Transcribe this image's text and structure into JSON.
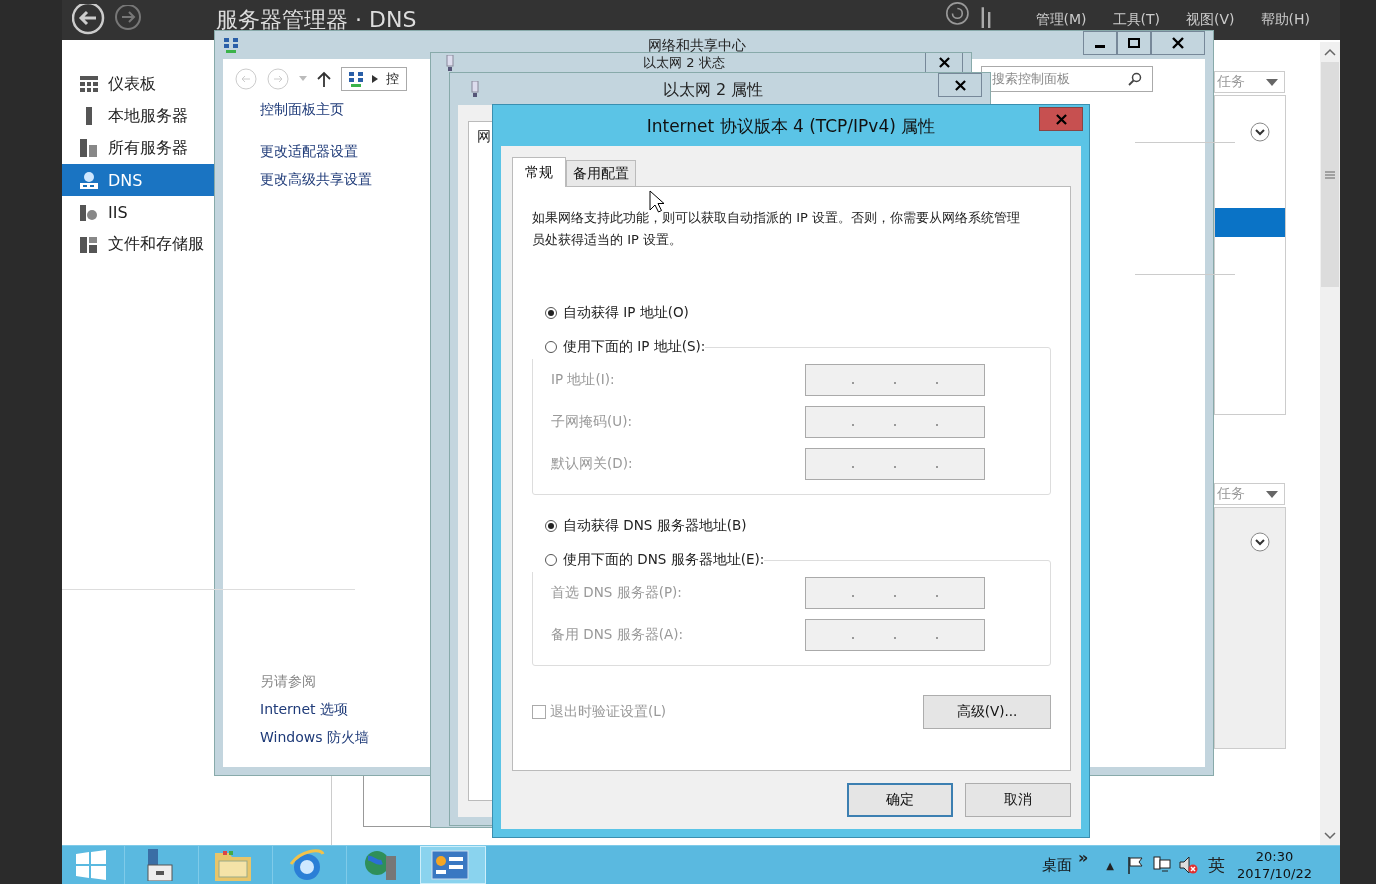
{
  "server_manager": {
    "title": "服务器管理器 · DNS",
    "menu": [
      {
        "label": "管理(M)"
      },
      {
        "label": "工具(T)"
      },
      {
        "label": "视图(V)"
      },
      {
        "label": "帮助(H)"
      }
    ],
    "sidebar": [
      {
        "label": "仪表板",
        "kind": "dashboard",
        "selected": false
      },
      {
        "label": "本地服务器",
        "kind": "server",
        "selected": false
      },
      {
        "label": "所有服务器",
        "kind": "servers",
        "selected": false
      },
      {
        "label": "DNS",
        "kind": "dns",
        "selected": true
      },
      {
        "label": "IIS",
        "kind": "iis",
        "selected": false
      },
      {
        "label": "文件和存储服",
        "kind": "storage",
        "selected": false
      }
    ],
    "task_menus": [
      {
        "label": "任务"
      },
      {
        "label": "任务"
      }
    ]
  },
  "network_center": {
    "title": "网络和共享中心",
    "address": "控",
    "search": {
      "placeholder": "搜索控制面板"
    },
    "links": [
      {
        "label": "控制面板主页"
      },
      {
        "label": "更改适配器设置"
      },
      {
        "label": "更改高级共享设置"
      }
    ],
    "see_also": {
      "heading": "另请参阅",
      "links": [
        {
          "label": "Internet 选项"
        },
        {
          "label": "Windows 防火墙"
        }
      ]
    }
  },
  "status_window": {
    "title": "以太网 2 状态"
  },
  "properties_window": {
    "title": "以太网 2 属性",
    "tab": "网"
  },
  "ipv4_dialog": {
    "title": "Internet 协议版本 4 (TCP/IPv4) 属性",
    "tabs": [
      {
        "label": "常规",
        "selected": true
      },
      {
        "label": "备用配置",
        "selected": false
      }
    ],
    "intro": "如果网络支持此功能，则可以获取自动指派的 IP 设置。否则，你需要从网络系统管理员处获得适当的 IP 设置。",
    "ip_options": [
      {
        "label": "自动获得 IP 地址(O)",
        "selected": true
      },
      {
        "label": "使用下面的 IP 地址(S):",
        "selected": false
      }
    ],
    "ip_fields": [
      {
        "label": "IP 地址(I):",
        "disabled": true
      },
      {
        "label": "子网掩码(U):",
        "disabled": true
      },
      {
        "label": "默认网关(D):",
        "disabled": true
      }
    ],
    "dns_options": [
      {
        "label": "自动获得 DNS 服务器地址(B)",
        "selected": true
      },
      {
        "label": "使用下面的 DNS 服务器地址(E):",
        "selected": false
      }
    ],
    "dns_fields": [
      {
        "label": "首选 DNS 服务器(P):",
        "disabled": true
      },
      {
        "label": "备用 DNS 服务器(A):",
        "disabled": true
      }
    ],
    "validate": {
      "label": "退出时验证设置(L)",
      "checked": false,
      "disabled": true
    },
    "advanced": "高级(V)...",
    "ok": "确定",
    "cancel": "取消"
  },
  "taskbar": {
    "apps": [
      {
        "kind": "server-manager",
        "selected": false
      },
      {
        "kind": "folder",
        "selected": false
      },
      {
        "kind": "browser",
        "selected": false
      },
      {
        "kind": "tools",
        "selected": false
      },
      {
        "kind": "control-panel",
        "selected": true
      }
    ],
    "toolbar": "桌面",
    "chevron": "»",
    "tray_arrow": "▲",
    "ime": "英",
    "time": "20:30",
    "date": "2017/10/22"
  }
}
